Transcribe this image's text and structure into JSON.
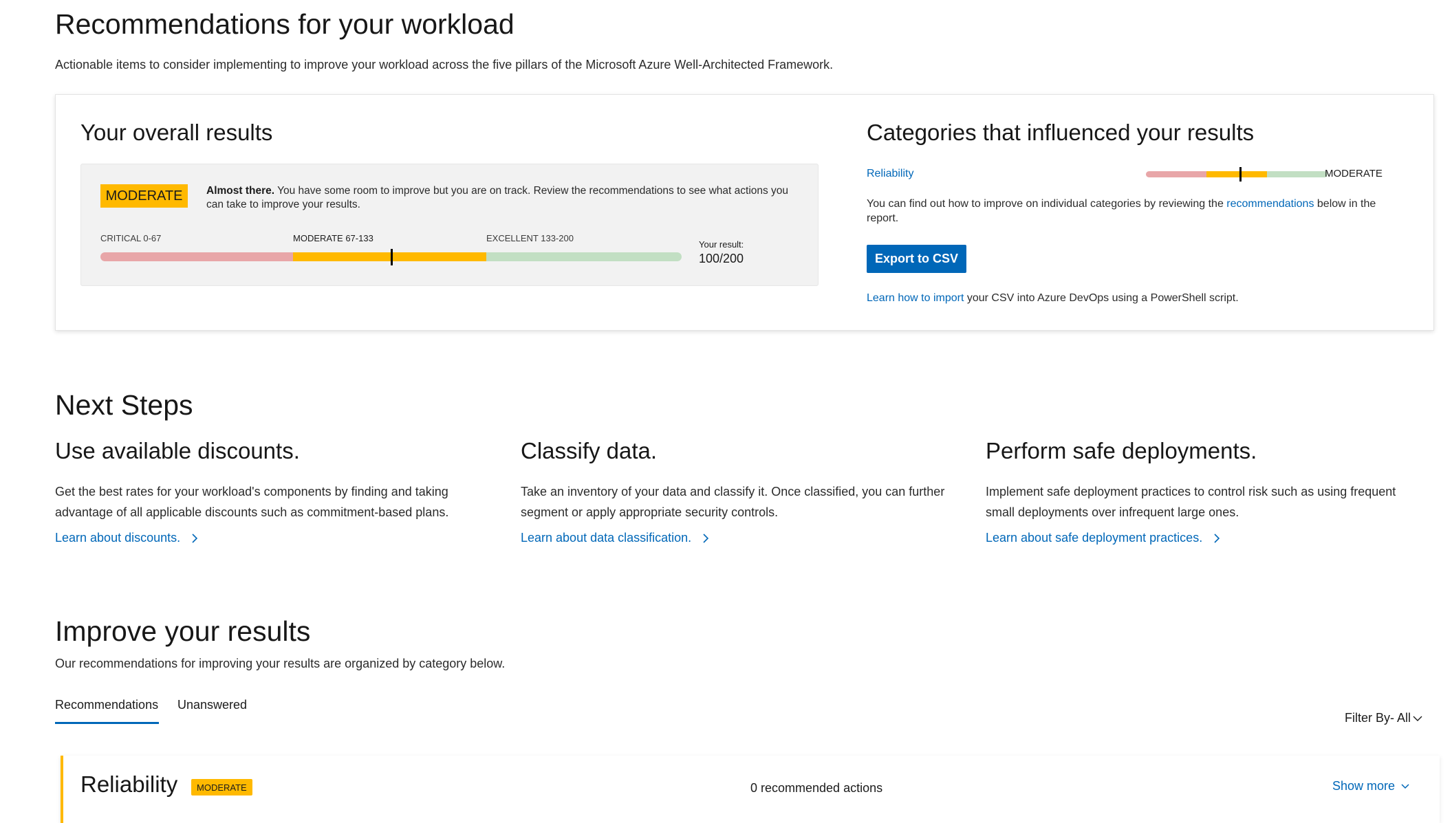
{
  "header": {
    "title": "Recommendations for your workload",
    "subtitle": "Actionable items to consider implementing to improve your workload across the five pillars of the Microsoft Azure Well-Architected Framework."
  },
  "overall": {
    "title": "Your overall results",
    "badge": "MODERATE",
    "message_bold": "Almost there.",
    "message_rest": " You have some room to improve but you are on track. Review the recommendations to see what actions you can take to improve your results.",
    "segments": [
      "CRITICAL 0-67",
      "MODERATE 67-133",
      "EXCELLENT 133-200"
    ],
    "your_result_label": "Your result:",
    "your_result_value": "100/200",
    "score": 100,
    "max": 200
  },
  "categories": {
    "title": "Categories that influenced your results",
    "items": [
      {
        "name": "Reliability",
        "level": "MODERATE",
        "score": 0.52
      }
    ],
    "text_before": "You can find out how to improve on individual categories by reviewing the ",
    "text_link": "recommendations",
    "text_after": " below in the report.",
    "export_button": "Export to CSV",
    "import_link": "Learn how to import",
    "import_rest": " your CSV into Azure DevOps using a PowerShell script."
  },
  "next_steps": {
    "title": "Next Steps",
    "items": [
      {
        "title": "Use available discounts.",
        "desc": "Get the best rates for your workload's components by finding and taking advantage of all applicable discounts such as commitment-based plans.",
        "link": "Learn about discounts."
      },
      {
        "title": "Classify data.",
        "desc": "Take an inventory of your data and classify it. Once classified, you can further segment or apply appropriate security controls.",
        "link": "Learn about data classification."
      },
      {
        "title": "Perform safe deployments.",
        "desc": "Implement safe deployment practices to control risk such as using frequent small deployments over infrequent large ones.",
        "link": "Learn about safe deployment practices."
      }
    ]
  },
  "improve": {
    "title": "Improve your results",
    "subtitle": "Our recommendations for improving your results are organized by category below.",
    "tabs": [
      "Recommendations",
      "Unanswered"
    ],
    "filter": "Filter By- All",
    "card": {
      "title": "Reliability",
      "badge": "MODERATE",
      "count": "0 recommended actions",
      "show_more": "Show more"
    }
  },
  "colors": {
    "critical": "#e8a6a8",
    "moderate": "#ffb900",
    "excellent": "#c2dfc3",
    "accent": "#0067b8"
  },
  "icons": [
    "chevron-right-icon",
    "chevron-down-icon"
  ]
}
